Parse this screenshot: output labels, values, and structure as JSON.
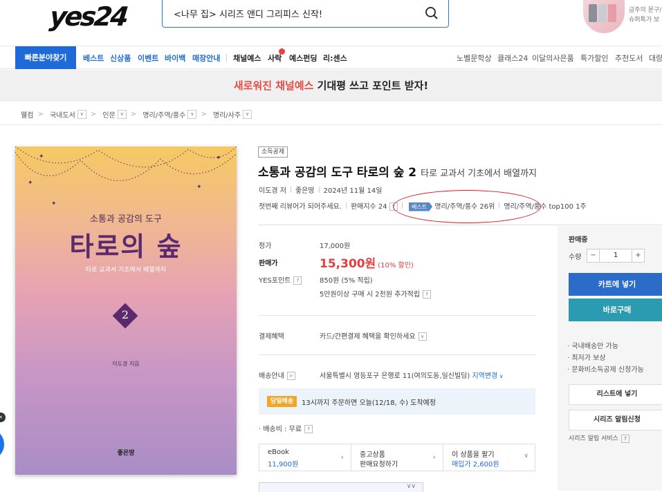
{
  "header": {
    "logo": "yes24",
    "search_value": "<나무 집> 시리즈 앤디 그리피스 신작!",
    "promo_line1": "금주의 문구/",
    "promo_line2": "슈퍼특가 보"
  },
  "nav": {
    "quickfind": "빠른분야찾기",
    "left": [
      "베스트",
      "신상품",
      "이벤트",
      "바이백",
      "매장안내"
    ],
    "mid": [
      "채널예스",
      "사락",
      "예스펀딩",
      "리:센스"
    ],
    "right": [
      "노벨문학상",
      "클래스24",
      "이달의사은품",
      "특가할인",
      "추천도서",
      "대량"
    ]
  },
  "banner": {
    "red": "새로워진 채널예스",
    "black": " 기대평 쓰고 포인트 받자!"
  },
  "breadcrumb": [
    "웰컴",
    "국내도서",
    "인문",
    "명리/주역/풍수",
    "명리/사주"
  ],
  "cover": {
    "subtitle": "소통과 공감의 도구",
    "title": "타로의 숲",
    "tagline": "타로 교과서 기초에서 배열까지",
    "volume": "2",
    "author": "이도경 지음",
    "publisher": "좋은땅"
  },
  "book": {
    "badge": "소득공제",
    "title": "소통과 공감의 도구 타로의 숲 2",
    "subtitle": "타로 교과서 기초에서 배열까지",
    "author": "이도경 저",
    "publisher": "좋은땅",
    "date": "2024년 11월 14일",
    "review": "첫번째 리뷰어가 되어주세요.",
    "sales_index": "판매지수 24",
    "best_tag": "베스트",
    "rank1": "명리/주역/풍수 26위",
    "rank2": "명리/주역/풍수 top100 1주"
  },
  "price": {
    "list_label": "정가",
    "list_value": "17,000원",
    "sale_label": "판매가",
    "sale_value": "15,300원",
    "sale_discount": "(10% 할인)",
    "point_label": "YES포인트",
    "point_value": "850원 (5% 적립)",
    "point_extra": "5만원이상 구매 시 2천원 추가적립",
    "pay_label": "결제혜택",
    "pay_value": "카드/간편결제 혜택을 확인하세요",
    "ship_label": "배송안내",
    "ship_value": "서울특별시 영등포구 은행로 11(여의도동,일신빌딩)",
    "ship_change": "지역변경",
    "today_badge": "당일배송",
    "today_text": "13시까지 주문하면 오늘(12/18, 수) 도착예정",
    "ship_fee": "· 배송비 : 무료"
  },
  "options": [
    {
      "title": "eBook",
      "value": "11,900원"
    },
    {
      "title": "중고상품",
      "value": "판매요청하기"
    },
    {
      "title": "이 상품을 팔기",
      "value": "매입가 2,600원"
    }
  ],
  "panel": {
    "status": "판매중",
    "qty_label": "수량",
    "qty_value": "1",
    "cart": "카트에 넣기",
    "buy": "바로구매",
    "perks": [
      "· 국내배송만 가능",
      "· 최저가 보상",
      "· 문화비소득공제 신청가능"
    ],
    "wishlist": "리스트에 넣기",
    "series": "시리즈 알림신청",
    "series_note": "시리즈 알림 서비스"
  },
  "colors": {
    "accent": "#1f6ad9",
    "price_red": "#e43e3e",
    "annotation": "#e4161d"
  }
}
